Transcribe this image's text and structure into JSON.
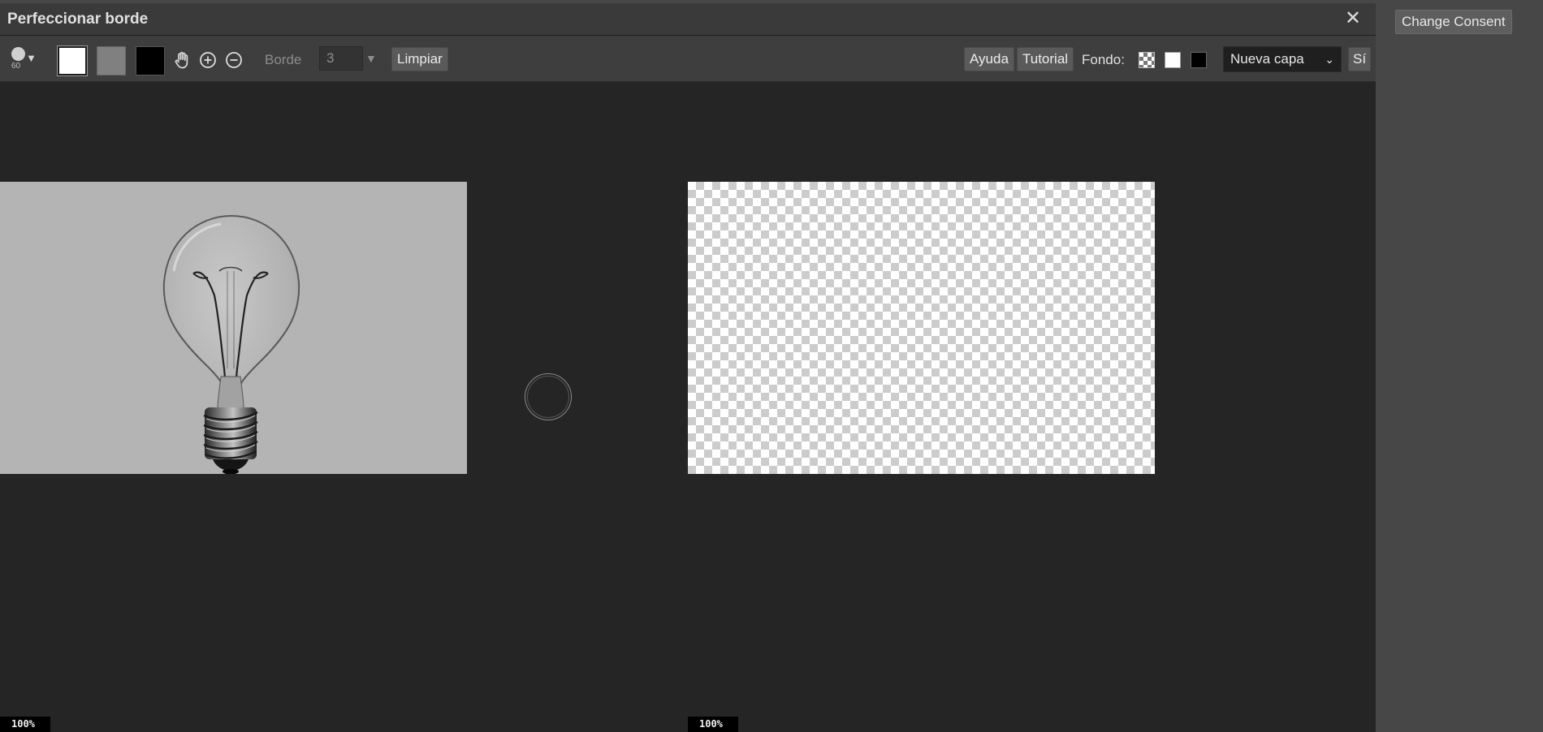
{
  "dialog": {
    "title": "Perfeccionar borde",
    "close_icon": "close-icon"
  },
  "toolbar": {
    "brush_size": "60",
    "brush_dropdown_icon": "chevron-down-icon",
    "swatch_colors": {
      "white": "#ffffff",
      "gray": "#808080",
      "black": "#000000"
    },
    "tools": [
      "hand-icon",
      "zoom-in-icon",
      "zoom-out-icon"
    ],
    "borde_label": "Borde",
    "borde_value": "3",
    "limpiar_label": "Limpiar",
    "ayuda_label": "Ayuda",
    "tutorial_label": "Tutorial",
    "fondo_label": "Fondo:",
    "layer_select": {
      "selected": "Nueva capa"
    },
    "si_label": "Sí"
  },
  "canvas": {
    "left_zoom": "100%",
    "right_zoom": "100%",
    "left_bg": "#b4b4b4"
  },
  "side_panel": {
    "consent_label": "Change Consent"
  }
}
